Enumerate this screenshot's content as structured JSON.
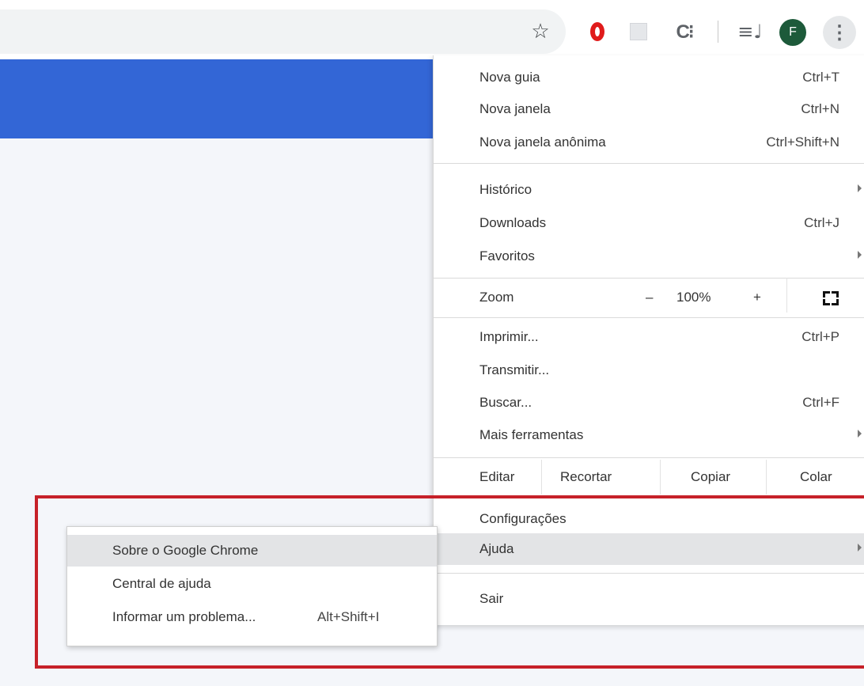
{
  "toolbar": {
    "icons": [
      "star-icon",
      "opera-icon",
      "extension-icon",
      "c-extension-icon",
      "queue-icon",
      "kebab-menu-icon"
    ],
    "avatar_letter": "F"
  },
  "menu": {
    "new_tab": {
      "label": "Nova guia",
      "shortcut": "Ctrl+T"
    },
    "new_window": {
      "label": "Nova janela",
      "shortcut": "Ctrl+N"
    },
    "incognito": {
      "label": "Nova janela anônima",
      "shortcut": "Ctrl+Shift+N"
    },
    "history": {
      "label": "Histórico"
    },
    "downloads": {
      "label": "Downloads",
      "shortcut": "Ctrl+J"
    },
    "bookmarks": {
      "label": "Favoritos"
    },
    "zoom": {
      "label": "Zoom",
      "minus": "–",
      "value": "100%",
      "plus": "+"
    },
    "print": {
      "label": "Imprimir...",
      "shortcut": "Ctrl+P"
    },
    "cast": {
      "label": "Transmitir..."
    },
    "find": {
      "label": "Buscar...",
      "shortcut": "Ctrl+F"
    },
    "more_tools": {
      "label": "Mais ferramentas"
    },
    "edit": {
      "label": "Editar",
      "cut": "Recortar",
      "copy": "Copiar",
      "paste": "Colar"
    },
    "settings": {
      "label": "Configurações"
    },
    "help": {
      "label": "Ajuda"
    },
    "exit": {
      "label": "Sair"
    }
  },
  "help_submenu": {
    "about": {
      "label": "Sobre o Google Chrome"
    },
    "help_center": {
      "label": "Central de ajuda"
    },
    "report_issue": {
      "label": "Informar um problema...",
      "shortcut": "Alt+Shift+I"
    }
  },
  "colors": {
    "banner": "#3366d6",
    "highlight_box": "#c62129",
    "avatar": "#1d5a3a"
  }
}
